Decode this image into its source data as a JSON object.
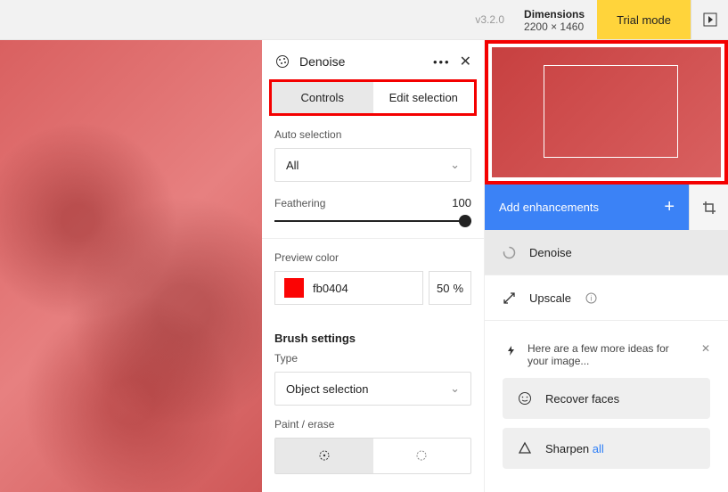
{
  "topbar": {
    "version": "v3.2.0",
    "dimensions_label": "Dimensions",
    "dimensions_value": "2200 × 1460",
    "trial": "Trial mode"
  },
  "panel": {
    "title": "Denoise",
    "tabs": {
      "controls": "Controls",
      "edit": "Edit selection"
    },
    "auto_selection_label": "Auto selection",
    "auto_selection_value": "All",
    "feathering_label": "Feathering",
    "feathering_value": "100",
    "preview_color_label": "Preview color",
    "color_hex": "fb0404",
    "color_pct": "50",
    "pct_symbol": "%",
    "brush_heading": "Brush settings",
    "type_label": "Type",
    "type_value": "Object selection",
    "paint_label": "Paint / erase"
  },
  "right": {
    "add": "Add enhancements",
    "items": [
      {
        "label": "Denoise"
      },
      {
        "label": "Upscale"
      }
    ],
    "ideas_text": "Here are a few more ideas for your image...",
    "idea1": "Recover faces",
    "idea2_a": "Sharpen ",
    "idea2_b": "all"
  },
  "colors": {
    "accent": "#3b82f6",
    "highlight": "#f40000",
    "trial": "#ffd43b",
    "swatch": "#fb0404"
  }
}
